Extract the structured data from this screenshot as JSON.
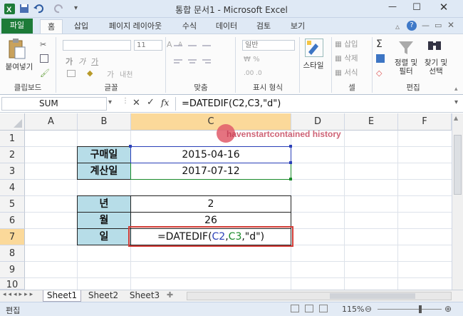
{
  "window": {
    "title": "통합 문서1 - Microsoft Excel"
  },
  "tabs": [
    "파일",
    "홈",
    "삽입",
    "페이지 레이아웃",
    "수식",
    "데이터",
    "검토",
    "보기"
  ],
  "ribbon": {
    "paste_label": "붙여넣기",
    "font_size": "11",
    "number_format": "일반",
    "style_label": "스타일",
    "insert_label": "삽입",
    "delete_label": "삭제",
    "format_label": "서식",
    "sort_label": "정렬 및\n필터",
    "find_label": "찾기 및\n선택",
    "groups": [
      "클립보드",
      "글꼴",
      "맞춤",
      "표시 형식",
      "셀",
      "편집"
    ]
  },
  "formula_bar": {
    "name_box": "SUM",
    "fx": "fx",
    "formula": "=DATEDIF(C2,C3,\"d\")"
  },
  "columns": [
    "A",
    "B",
    "C",
    "D",
    "E",
    "F"
  ],
  "rows": [
    "1",
    "2",
    "3",
    "4",
    "5",
    "6",
    "7",
    "8",
    "9",
    "10"
  ],
  "cells": {
    "b2": "구매일",
    "c2": "2015-04-16",
    "b3": "계산일",
    "c3": "2017-07-12",
    "b5": "년",
    "c5": "2",
    "b6": "월",
    "c6": "26",
    "b7": "일",
    "c7_parts": {
      "eq": "=DATEDIF(",
      "ref1": "C2",
      "comma1": ",",
      "ref2": "C3",
      "rest": ",\"d\")"
    }
  },
  "watermark": "havenstartcontained history",
  "sheet_tabs": [
    "Sheet1",
    "Sheet2",
    "Sheet3"
  ],
  "status": {
    "mode": "편집",
    "zoom": "115%"
  },
  "colors": {
    "accent_green": "#1d7b38",
    "ref_blue": "#2a3fb8",
    "ref_green": "#1a8a2a",
    "highlight_red": "#d23c36",
    "header_highlight": "#fbd99a"
  }
}
